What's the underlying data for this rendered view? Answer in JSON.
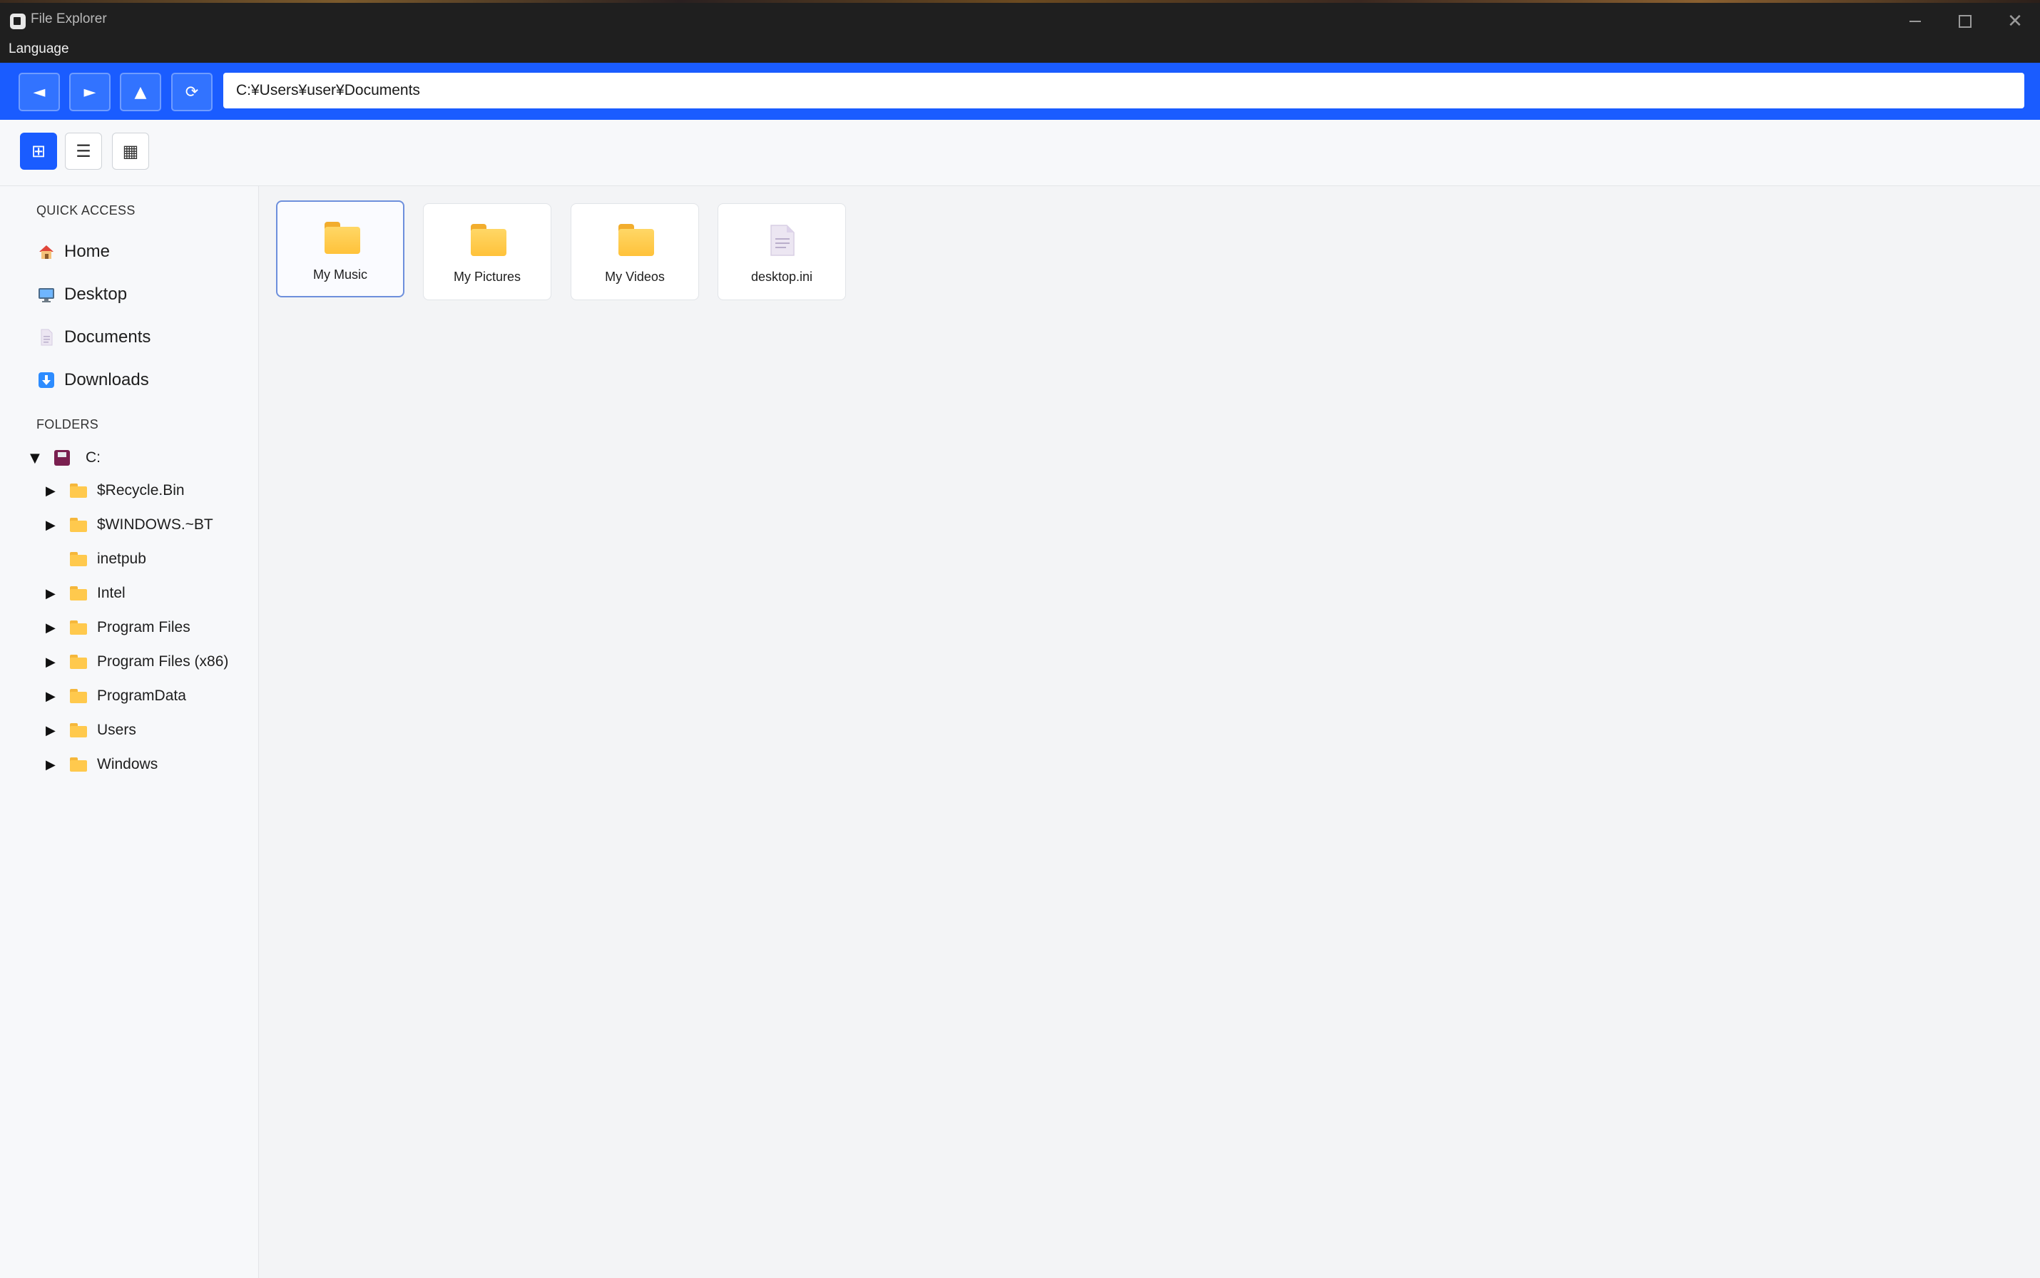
{
  "window": {
    "title": "File Explorer"
  },
  "menu": {
    "language": "Language"
  },
  "nav": {
    "back_icon": "◄",
    "forward_icon": "►",
    "up_icon": "▲",
    "refresh_icon": "⟳",
    "address": "C:¥Users¥user¥Documents"
  },
  "view_modes": {
    "grid_icon": "⊞",
    "list_icon": "☰",
    "table_icon": "▦",
    "active": "grid"
  },
  "sidebar": {
    "quick_access_title": "QUICK ACCESS",
    "quick_access": [
      {
        "label": "Home",
        "icon": "house-icon"
      },
      {
        "label": "Desktop",
        "icon": "monitor-icon"
      },
      {
        "label": "Documents",
        "icon": "document-icon"
      },
      {
        "label": "Downloads",
        "icon": "download-arrow-icon"
      }
    ],
    "folders_title": "FOLDERS",
    "drive": {
      "label": "C:",
      "expanded": true
    },
    "tree": [
      {
        "label": "$Recycle.Bin",
        "expandable": true
      },
      {
        "label": "$WINDOWS.~BT",
        "expandable": true
      },
      {
        "label": "inetpub",
        "expandable": false
      },
      {
        "label": "Intel",
        "expandable": true
      },
      {
        "label": "Program Files",
        "expandable": true
      },
      {
        "label": "Program Files (x86)",
        "expandable": true
      },
      {
        "label": "ProgramData",
        "expandable": true
      },
      {
        "label": "Users",
        "expandable": true
      },
      {
        "label": "Windows",
        "expandable": true
      }
    ]
  },
  "content": {
    "items": [
      {
        "label": "My Music",
        "type": "folder",
        "selected": true
      },
      {
        "label": "My Pictures",
        "type": "folder",
        "selected": false
      },
      {
        "label": "My Videos",
        "type": "folder",
        "selected": false
      },
      {
        "label": "desktop.ini",
        "type": "file",
        "selected": false
      }
    ]
  },
  "colors": {
    "accent": "#1a5cff",
    "titlebar": "#1f1f1f",
    "folder": "#ffc94d"
  },
  "caret_expanded": "▼",
  "caret_collapsed": "▶"
}
